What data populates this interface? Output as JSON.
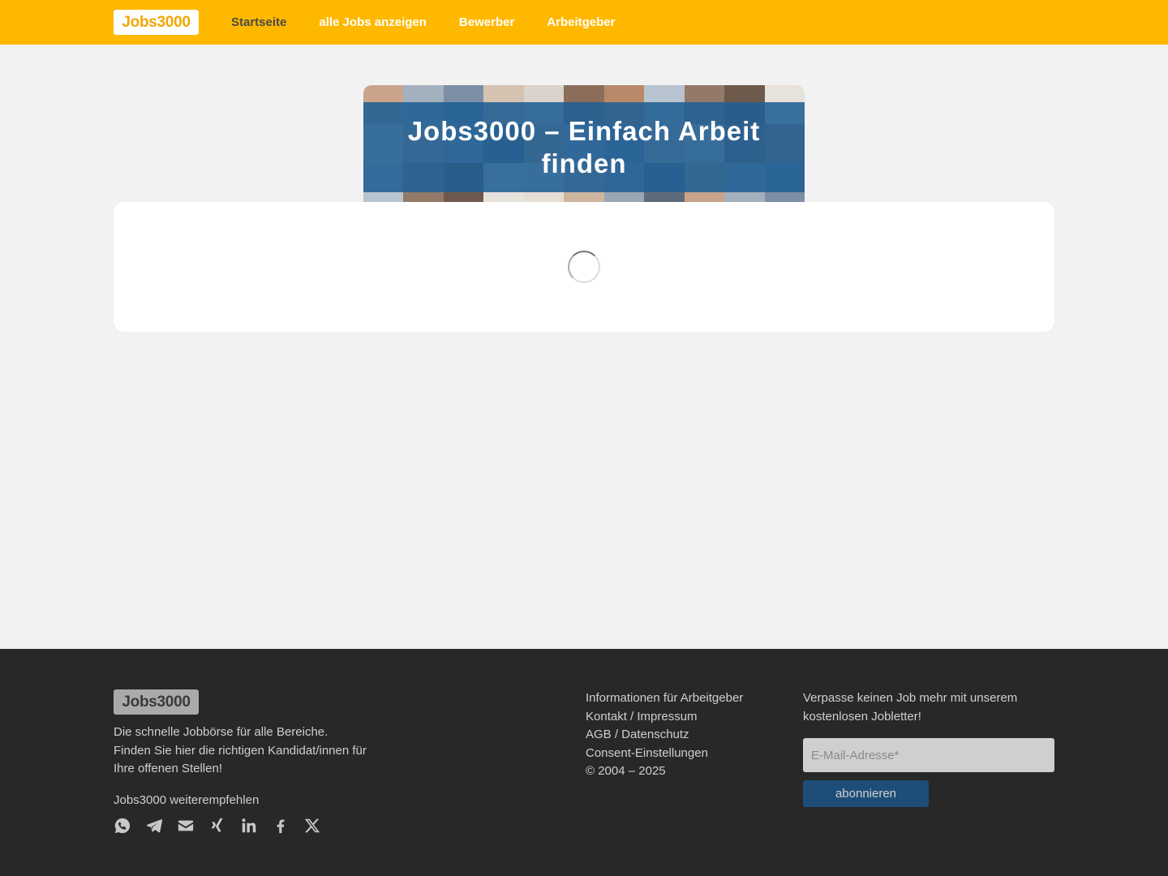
{
  "header": {
    "logo": "Jobs3000",
    "nav": [
      {
        "label": "Startseite",
        "active": true
      },
      {
        "label": "alle Jobs anzeigen",
        "active": false
      },
      {
        "label": "Bewerber",
        "active": false
      },
      {
        "label": "Arbeitgeber",
        "active": false
      }
    ]
  },
  "hero": {
    "title": "Jobs3000 – Einfach Arbeit finden"
  },
  "main": {
    "loading_indicator": "spinner-icon"
  },
  "footer": {
    "logo": "Jobs3000",
    "tagline": "Die schnelle Jobbörse für alle Bereiche.\nFinden Sie hier die richtigen Kandidat/innen  für Ihre offenen Stellen!",
    "share_label": "Jobs3000 weiterempfehlen",
    "share_icons": [
      "whatsapp-icon",
      "telegram-icon",
      "email-icon",
      "xing-icon",
      "linkedin-icon",
      "facebook-icon",
      "x-icon"
    ],
    "links": [
      "Informationen für Arbeitgeber",
      "Kontakt / Impressum",
      "AGB / Datenschutz",
      "Consent-Einstellungen",
      "© 2004 – 2025"
    ],
    "newsletter": {
      "text": "Verpasse keinen Job mehr mit unserem kostenlosen Jobletter!",
      "email_placeholder": "E-Mail-Adresse*",
      "button_label": "abonnieren"
    }
  },
  "colors": {
    "brand_yellow": "#ffb800",
    "hero_blue": "#205e94",
    "footer_bg": "#282828",
    "button_blue": "#1e4e78"
  }
}
